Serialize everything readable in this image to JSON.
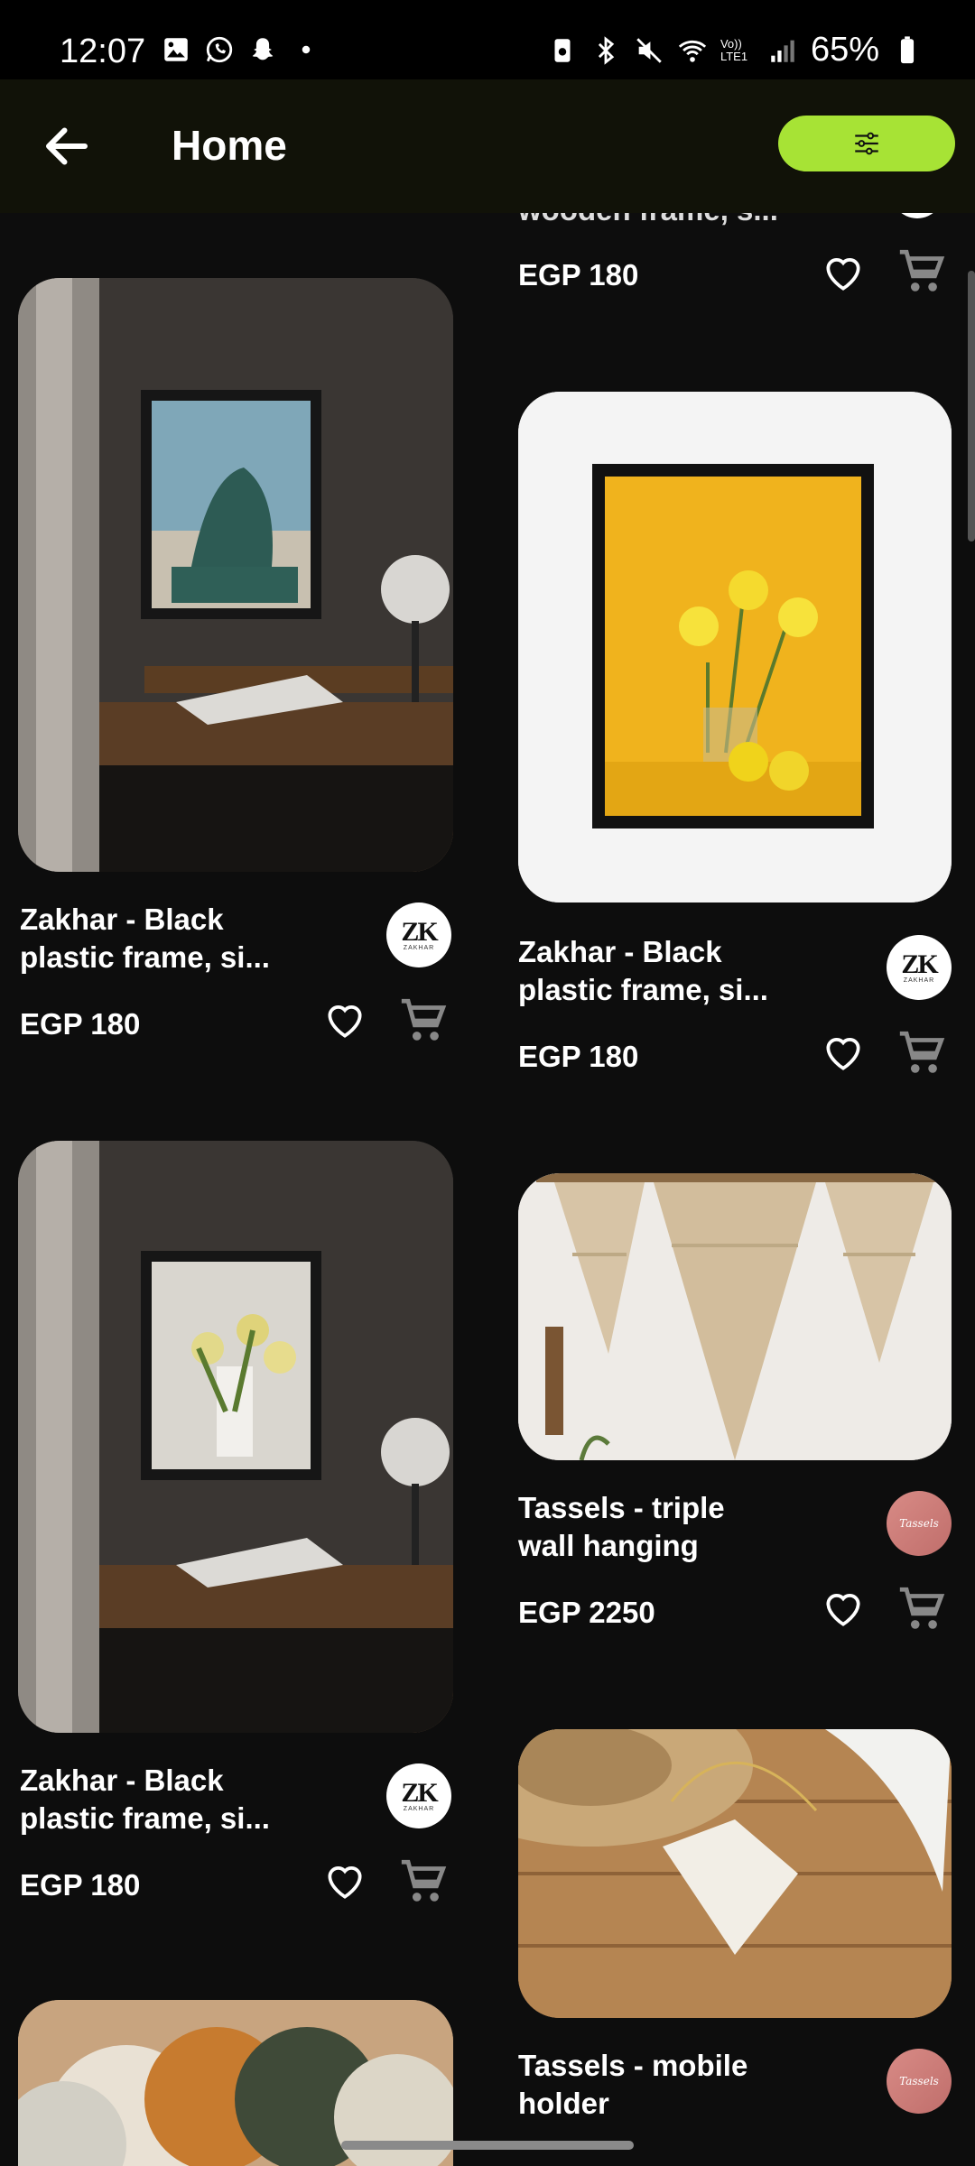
{
  "status": {
    "time": "12:07",
    "battery": "65%",
    "signal_label": "Vo)) LTE1"
  },
  "header": {
    "title": "Home"
  },
  "partial_top": {
    "title_fragment": "wooden frame, s...",
    "price": "EGP 180"
  },
  "products": [
    {
      "title_line1": "Zakhar - Black",
      "title_line2": "plastic frame, si...",
      "price": "EGP 180",
      "brand": "ZAKHAR"
    },
    {
      "title_line1": "Zakhar - Black",
      "title_line2": "plastic frame, si...",
      "price": "EGP 180",
      "brand": "ZAKHAR"
    },
    {
      "title_line1": "Zakhar - Black",
      "title_line2": "plastic frame, si...",
      "price": "EGP 180",
      "brand": "ZAKHAR"
    },
    {
      "title_line1": "Tassels - triple",
      "title_line2": "wall hanging",
      "price": "EGP 2250",
      "brand": "Tassels"
    },
    {
      "title_line1": "Tassels - mobile",
      "title_line2": "holder",
      "price": "",
      "brand": "Tassels"
    }
  ],
  "brand_logos": {
    "zk_letters": "ZK",
    "zk_sub": "ZAKHAR",
    "tassels_script": "Tassels"
  },
  "colors": {
    "accent": "#a7e335",
    "background": "#0d0d0d",
    "header_bg": "#111208"
  }
}
